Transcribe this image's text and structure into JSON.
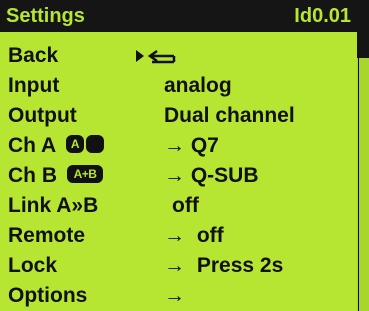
{
  "header": {
    "title": "Settings",
    "version": "Id0.01"
  },
  "menu": {
    "back": {
      "label": "Back"
    },
    "input": {
      "label": "Input",
      "value": "analog"
    },
    "output": {
      "label": "Output",
      "value": "Dual channel"
    },
    "ch_a": {
      "label": "Ch A",
      "badge": "A",
      "arrow": "→",
      "value": "Q7"
    },
    "ch_b": {
      "label": "Ch B",
      "badge": "A+B",
      "arrow": "→",
      "value": "Q-SUB"
    },
    "link": {
      "label": "Link A»B",
      "value": "off"
    },
    "remote": {
      "label": "Remote",
      "arrow": "→",
      "value": "off"
    },
    "lock": {
      "label": "Lock",
      "arrow": "→",
      "value": "Press 2s"
    },
    "options": {
      "label": "Options",
      "arrow": "→"
    }
  },
  "scrollbar": {
    "position_fraction": 0.0
  }
}
